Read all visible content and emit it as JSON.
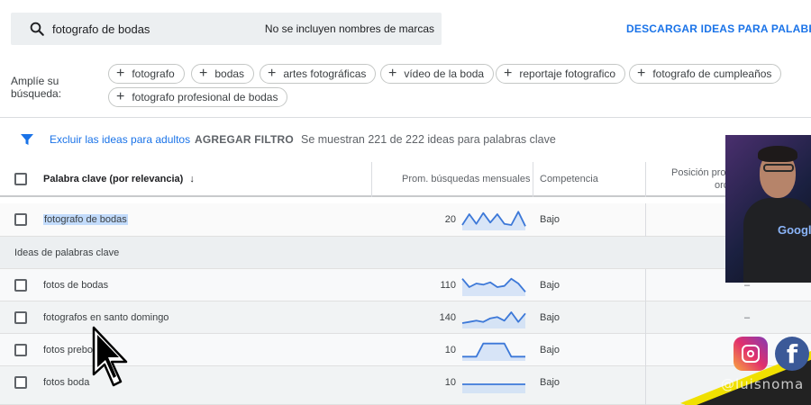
{
  "search": {
    "query": "fotografo de bodas",
    "brand_note": "No se incluyen nombres de marcas"
  },
  "download_link": "DESCARGAR IDEAS PARA PALABRAS",
  "broaden": {
    "label_line1": "Amplíe su",
    "label_line2": "búsqueda:",
    "chips": [
      "fotografo",
      "bodas",
      "artes fotográficas",
      "vídeo de la boda",
      "reportaje fotografico",
      "fotografo de cumpleaños",
      "fotografo profesional de bodas"
    ]
  },
  "filter_bar": {
    "exclude_adult": "Excluir las ideas para adultos",
    "add_filter": "AGREGAR FILTRO",
    "count_text": "Se muestran 221 de 222 ideas para palabras clave"
  },
  "table": {
    "columns": {
      "keyword": "Palabra clave (por relevancia)",
      "monthly": "Prom. búsquedas mensuales",
      "competition": "Competencia",
      "position_line1": "Posición pro",
      "position_line2": "orc"
    },
    "searched_row": {
      "keyword": "fotografo de bodas",
      "monthly": "20",
      "competition": "Bajo",
      "trend": [
        3,
        12,
        4,
        13,
        5,
        12,
        4,
        3,
        14,
        2
      ]
    },
    "section_label": "Ideas de palabras clave",
    "rows": [
      {
        "keyword": "fotos de bodas",
        "monthly": "110",
        "competition": "Bajo",
        "position": "–",
        "trend": [
          13,
          6,
          9,
          8,
          10,
          6,
          7,
          13,
          9,
          2
        ]
      },
      {
        "keyword": "fotografos en santo domingo",
        "monthly": "140",
        "competition": "Bajo",
        "position": "–",
        "trend": [
          3,
          4,
          5,
          4,
          7,
          8,
          5,
          12,
          4,
          11
        ]
      },
      {
        "keyword": "fotos prebo",
        "monthly": "10",
        "competition": "Bajo",
        "position": "",
        "trend": [
          2,
          2,
          2,
          13,
          13,
          13,
          13,
          2,
          2,
          2
        ]
      },
      {
        "keyword": "fotos boda",
        "monthly": "10",
        "competition": "Bajo",
        "position": "",
        "trend": [
          6,
          6,
          6,
          6,
          6,
          6,
          6,
          6,
          6,
          6
        ]
      }
    ]
  },
  "overlay": {
    "shirt_text": "Googl",
    "handle": "@luisnoma"
  },
  "colors": {
    "accent_blue": "#1a73e8",
    "spark_line": "#3c78d8",
    "spark_fill": "#c9dbf5",
    "highlight": "#c2dbfb"
  },
  "icons": [
    "search-icon",
    "plus-icon",
    "filter-icon",
    "sort-arrow-icon",
    "instagram-icon",
    "facebook-icon",
    "mouse-cursor-icon"
  ]
}
